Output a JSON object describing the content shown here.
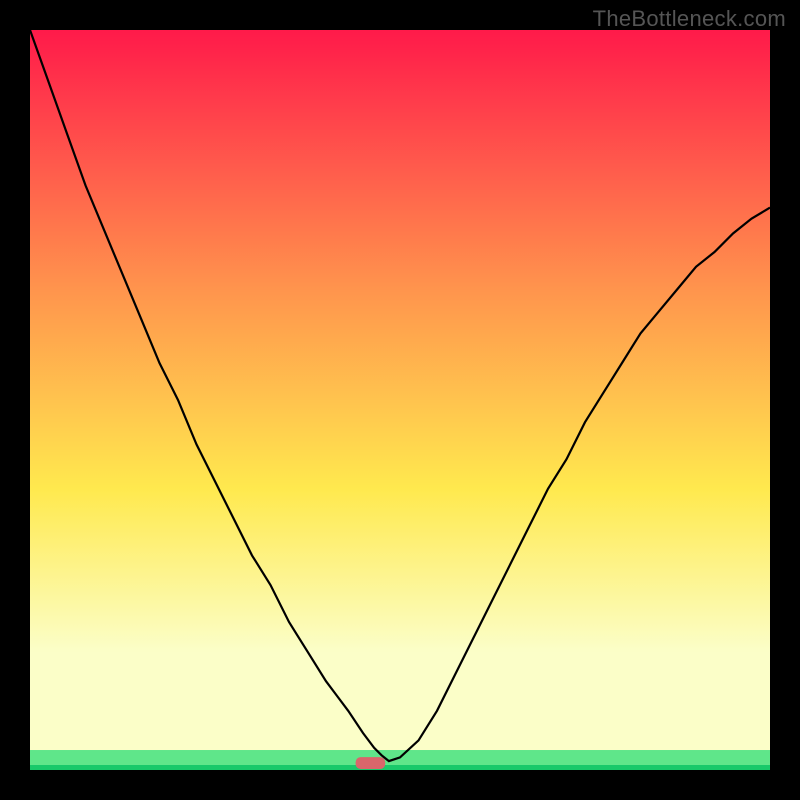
{
  "watermark": "TheBottleneck.com",
  "colors": {
    "top": "#ff1a4a",
    "mid1": "#ff944d",
    "mid2": "#ffe94e",
    "low": "#fbfec8",
    "bottom_band": "#5fe68a",
    "bottom_line": "#18c96a",
    "curve": "#000000",
    "marker": "#d9666b",
    "frame": "#000000"
  },
  "chart_data": {
    "type": "line",
    "title": "",
    "xlabel": "",
    "ylabel": "",
    "xlim": [
      0,
      100
    ],
    "ylim": [
      0,
      100
    ],
    "note": "Axes unlabeled; values are normalized 0–100 readings of the plotted curve height across the horizontal range. No tick labels are shown in the image.",
    "x": [
      0,
      2.5,
      5,
      7.5,
      10,
      12.5,
      15,
      17.5,
      20,
      22.5,
      25,
      27.5,
      30,
      32.5,
      35,
      37.5,
      40,
      41.5,
      43,
      45,
      46.5,
      47.5,
      48.5,
      50,
      52.5,
      55,
      57.5,
      60,
      62.5,
      65,
      67.5,
      70,
      72.5,
      75,
      77.5,
      80,
      82.5,
      85,
      87.5,
      90,
      92.5,
      95,
      97.5,
      100
    ],
    "values": [
      100,
      93,
      86,
      79,
      73,
      67,
      61,
      55,
      50,
      44,
      39,
      34,
      29,
      25,
      20,
      16,
      12,
      10,
      8,
      5,
      3,
      2,
      1.2,
      1.7,
      4,
      8,
      13,
      18,
      23,
      28,
      33,
      38,
      42,
      47,
      51,
      55,
      59,
      62,
      65,
      68,
      70,
      72.5,
      74.5,
      76
    ],
    "marker": {
      "x_center": 46,
      "width": 4,
      "height": 1.6
    },
    "green_band": {
      "from_y": 0,
      "to_y": 2.7
    },
    "pale_band": {
      "from_y": 2.7,
      "to_y": 16
    }
  }
}
